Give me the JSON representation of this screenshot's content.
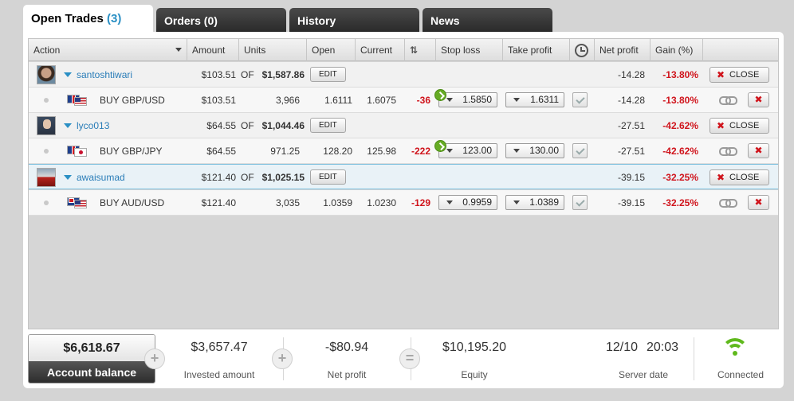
{
  "tabs": {
    "open_trades": {
      "label": "Open Trades",
      "count": "(3)"
    },
    "orders": "Orders (0)",
    "history": "History",
    "news": "News"
  },
  "columns": {
    "action": "Action",
    "amount": "Amount",
    "units": "Units",
    "open": "Open",
    "current": "Current",
    "stop_loss": "Stop loss",
    "take_profit": "Take profit",
    "net_profit": "Net profit",
    "gain": "Gain (%)"
  },
  "labels": {
    "of": "OF",
    "edit": "EDIT",
    "close": "CLOSE",
    "close_x": "✖",
    "remove_x": "✖",
    "sort_glyph": "⇅"
  },
  "owners": [
    {
      "name": "santoshtiwari",
      "amount": "$103.51",
      "total": "$1,587.86",
      "net_profit": "-14.28",
      "gain": "-13.80%"
    },
    {
      "name": "lyco013",
      "amount": "$64.55",
      "total": "$1,044.46",
      "net_profit": "-27.51",
      "gain": "-42.62%"
    },
    {
      "name": "awaisumad",
      "amount": "$121.40",
      "total": "$1,025.15",
      "net_profit": "-39.15",
      "gain": "-32.25%"
    }
  ],
  "trades": [
    {
      "action": "BUY GBP/USD",
      "amount": "$103.51",
      "units": "3,966",
      "open": "1.6111",
      "current": "1.6075",
      "pips": "-36",
      "stop_loss": "1.5850",
      "take_profit": "1.6311",
      "net_profit": "-14.28",
      "gain": "-13.80%"
    },
    {
      "action": "BUY GBP/JPY",
      "amount": "$64.55",
      "units": "971.25",
      "open": "128.20",
      "current": "125.98",
      "pips": "-222",
      "stop_loss": "123.00",
      "take_profit": "130.00",
      "net_profit": "-27.51",
      "gain": "-42.62%"
    },
    {
      "action": "BUY AUD/USD",
      "amount": "$121.40",
      "units": "3,035",
      "open": "1.0359",
      "current": "1.0230",
      "pips": "-129",
      "stop_loss": "0.9959",
      "take_profit": "1.0389",
      "net_profit": "-39.15",
      "gain": "-32.25%"
    }
  ],
  "footer": {
    "account_balance": {
      "value": "$6,618.67",
      "label": "Account balance"
    },
    "invested": {
      "value": "$3,657.47",
      "label": "Invested amount"
    },
    "net_profit": {
      "value": "-$80.94",
      "label": "Net profit"
    },
    "equity": {
      "value": "$10,195.20",
      "label": "Equity"
    },
    "server": {
      "date": "12/10",
      "time": "20:03",
      "label": "Server date"
    },
    "connection": {
      "label": "Connected"
    },
    "ops": {
      "plus1": "+",
      "plus2": "+",
      "equals": "="
    }
  },
  "colors": {
    "accent": "#2a8fc4",
    "negative": "#d0141c",
    "connected": "#5fb91c"
  }
}
